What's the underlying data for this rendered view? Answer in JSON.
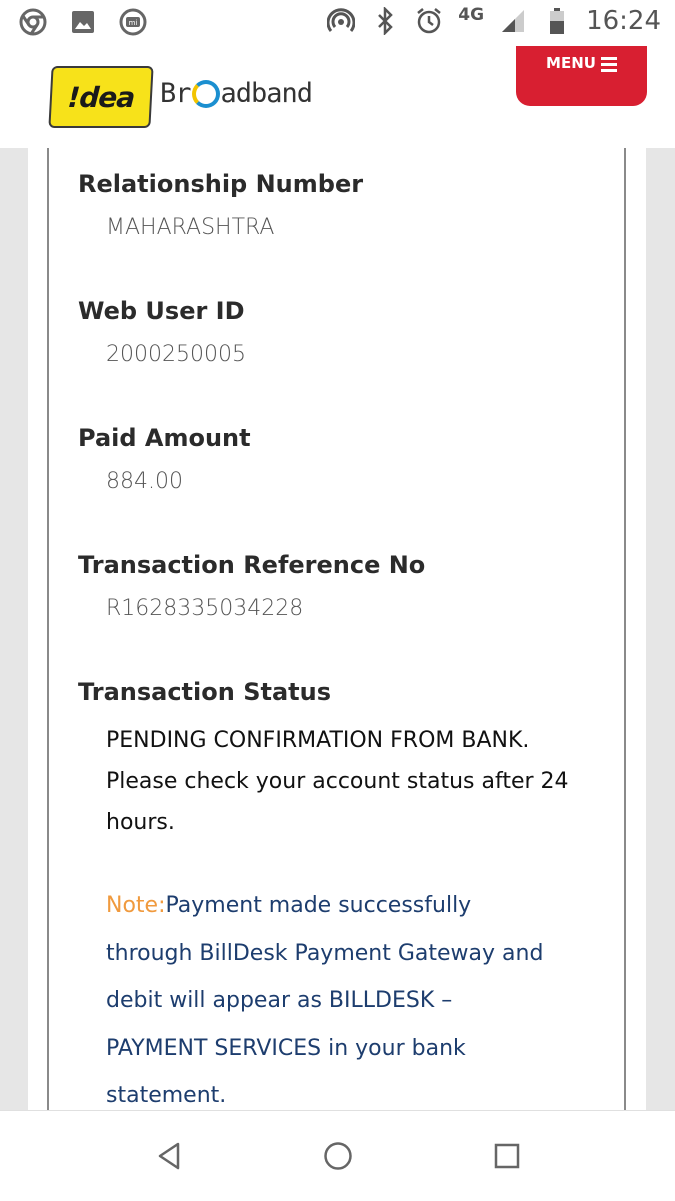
{
  "status_bar": {
    "network": "4G",
    "time": "16:24",
    "left_icons": [
      "chrome-icon",
      "gallery-icon",
      "mi-icon"
    ],
    "right_icons": [
      "hotspot-icon",
      "bluetooth-icon",
      "alarm-icon",
      "signal-icon",
      "battery-icon"
    ]
  },
  "header": {
    "logo_idea_text": "!dea",
    "logo_broadband_pre": "Br",
    "logo_broadband_post": "adband",
    "menu_label": "MENU"
  },
  "fields": [
    {
      "label": "Relationship Number",
      "value": "MAHARASHTRA"
    },
    {
      "label": "Web User ID",
      "value": "2000250005"
    },
    {
      "label": "Paid Amount",
      "value": "884.00"
    },
    {
      "label": "Transaction Reference No",
      "value": "R1628335034228"
    }
  ],
  "transaction_status": {
    "label": "Transaction Status",
    "text": "PENDING CONFIRMATION FROM BANK. Please check your account status after 24 hours.",
    "note_label": "Note:",
    "note_text": "Payment made successfully through BillDesk Payment Gateway and debit will appear as BILLDESK – PAYMENT SERVICES in your bank statement."
  },
  "colors": {
    "menu_bg": "#d81f31",
    "note_label": "#f09a3e",
    "note_text": "#1d3d6e",
    "logo_yellow": "#f7e21a"
  }
}
